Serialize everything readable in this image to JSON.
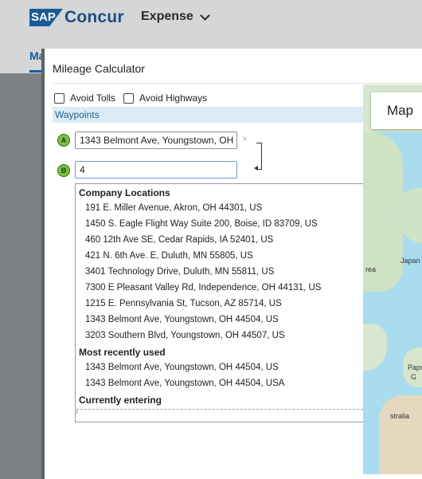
{
  "header": {
    "brand_sap": "SAP",
    "brand_concur": "Concur",
    "app_menu_label": "Expense",
    "background_tab": "Ma"
  },
  "dialog": {
    "title": "Mileage Calculator",
    "options": {
      "avoid_tolls": {
        "label": "Avoid Tolls",
        "checked": false
      },
      "avoid_highways": {
        "label": "Avoid Highways",
        "checked": false
      }
    },
    "waypoints_label": "Waypoints",
    "waypoints": [
      {
        "marker": "A",
        "value": "1343 Belmont Ave, Youngstown, OH",
        "clear_label": "×"
      },
      {
        "marker": "B",
        "value": "4"
      }
    ]
  },
  "dropdown": {
    "groups": [
      {
        "label": "Company Locations",
        "items": [
          "191 E. Miller Avenue, Akron, OH 44301, US",
          "1450 S. Eagle Flight Way Suite 200, Boise, ID 83709, US",
          "460 12th Ave SE, Cedar Rapids, IA 52401, US",
          "421 N. 6th Ave. E, Duluth, MN 55805, US",
          "3401 Technology Drive, Duluth, MN 55811, US",
          "7300 E Pleasant Valley Rd, Independence, OH 44131, US",
          "1215 E. Pennsylvania St, Tucson, AZ 85714, US",
          "1343 Belmont Ave, Youngstown, OH 44504, US",
          "3203 Southern Blvd, Youngstown, OH 44507, US"
        ]
      },
      {
        "label": "Most recently used",
        "items": [
          "1343 Belmont Ave, Youngstown, OH 44504, US",
          "1343 Belmont Ave, Youngstown, OH 44504, USA"
        ]
      },
      {
        "label": "Currently entering",
        "items": []
      }
    ]
  },
  "map": {
    "button_label": "Map",
    "labels": [
      "Japan",
      "rea",
      "Papu",
      "G",
      "stralia"
    ]
  },
  "colors": {
    "brand_blue": "#1a5b96",
    "marker_green": "#7bc043",
    "waypoints_bar": "#dcecf7",
    "overlay": "#7f8285"
  }
}
